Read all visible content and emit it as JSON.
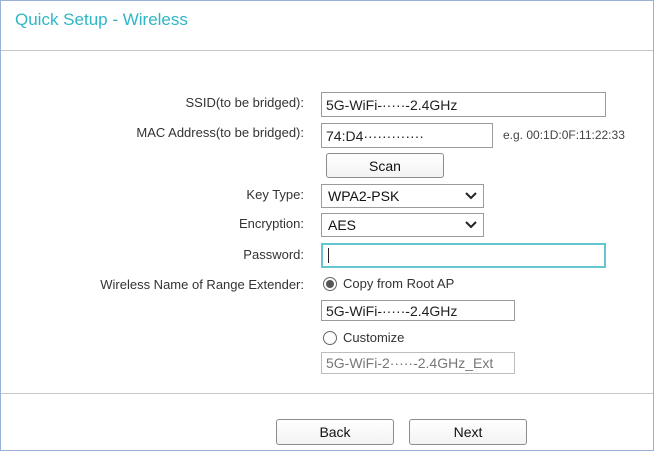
{
  "page": {
    "title": "Quick Setup - Wireless"
  },
  "form": {
    "ssid_label": "SSID(to be bridged):",
    "ssid_value": "5G-WiFi-·····-2.4GHz",
    "mac_label": "MAC Address(to be bridged):",
    "mac_value": "74:D4·············",
    "mac_hint": "e.g. 00:1D:0F:11:22:33",
    "scan_label": "Scan",
    "key_type_label": "Key Type:",
    "key_type_value": "WPA2-PSK",
    "encryption_label": "Encryption:",
    "encryption_value": "AES",
    "password_label": "Password:",
    "password_value": "",
    "extender_name_label": "Wireless Name of Range Extender:",
    "copy_from_root_label": "Copy from Root AP",
    "copy_from_root_selected": true,
    "copy_from_root_value": "5G-WiFi-·····-2.4GHz",
    "customize_label": "Customize",
    "customize_selected": false,
    "customize_value": "5G-WiFi-2·····-2.4GHz_Ext"
  },
  "footer": {
    "back_label": "Back",
    "next_label": "Next"
  },
  "icons": {
    "select_chevron": "chevron-down-icon",
    "radio_selected": "radio-selected-icon",
    "radio_unselected": "radio-unselected-icon"
  },
  "colors": {
    "title": "#2fb6c6",
    "focus_border": "#66c6cf",
    "frame_border": "#9ab0d6"
  }
}
